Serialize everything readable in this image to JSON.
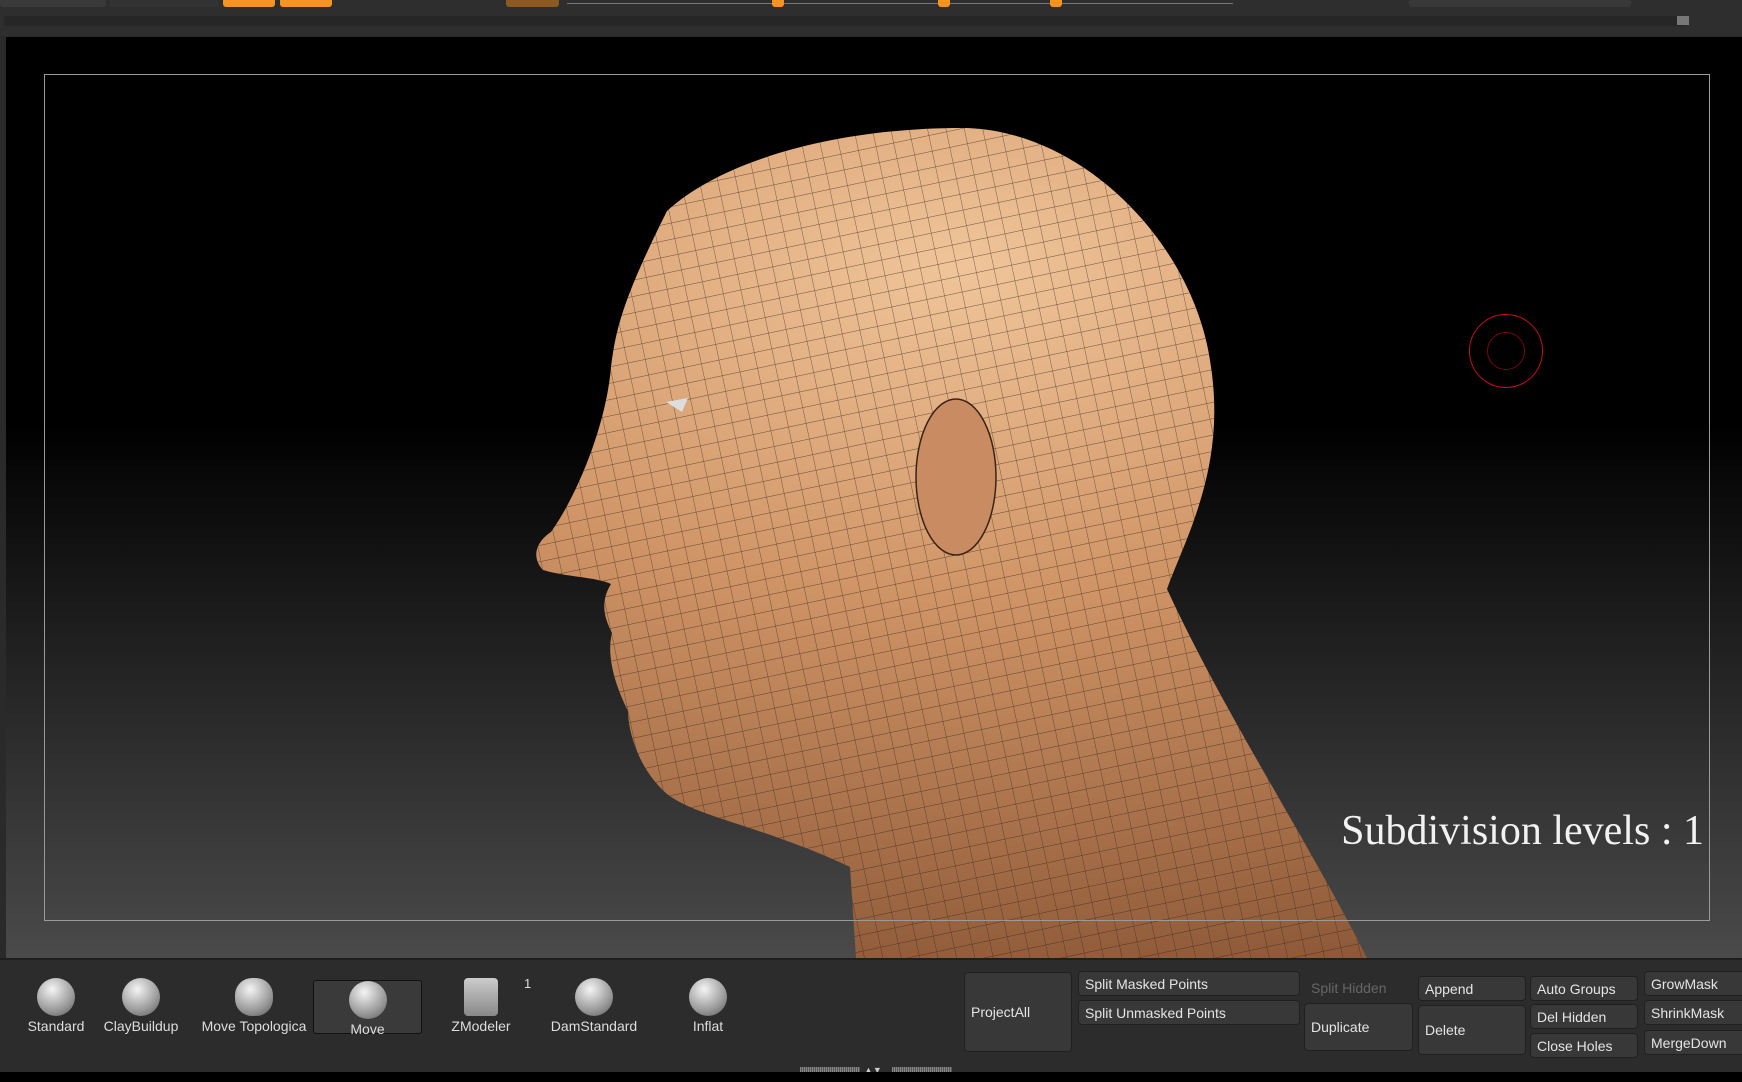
{
  "viewport": {
    "subdivision_text": "Subdivision levels : 1"
  },
  "brushes": [
    {
      "label": "Standard",
      "icon": "standard-brush-icon"
    },
    {
      "label": "ClayBuildup",
      "icon": "claybuildup-brush-icon"
    },
    {
      "label": "Move Topologica",
      "icon": "move-topological-brush-icon"
    },
    {
      "label": "Move",
      "icon": "move-brush-icon",
      "selected": true
    },
    {
      "label": "ZModeler",
      "icon": "zmodeler-brush-icon",
      "badge": "1"
    },
    {
      "label": "DamStandard",
      "icon": "damstandard-brush-icon"
    },
    {
      "label": "Inflat",
      "icon": "inflat-brush-icon"
    }
  ],
  "buttons": {
    "project_all": "ProjectAll",
    "split_masked": "Split Masked Points",
    "split_unmasked": "Split Unmasked Points",
    "split_hidden": "Split Hidden",
    "duplicate": "Duplicate",
    "append": "Append",
    "delete": "Delete",
    "auto_groups": "Auto Groups",
    "del_hidden": "Del Hidden",
    "close_holes": "Close Holes",
    "grow_mask": "GrowMask",
    "shrink_mask": "ShrinkMask",
    "merge_down": "MergeDown"
  },
  "colors": {
    "accent": "#f7931e",
    "cursor": "#c0141a"
  }
}
